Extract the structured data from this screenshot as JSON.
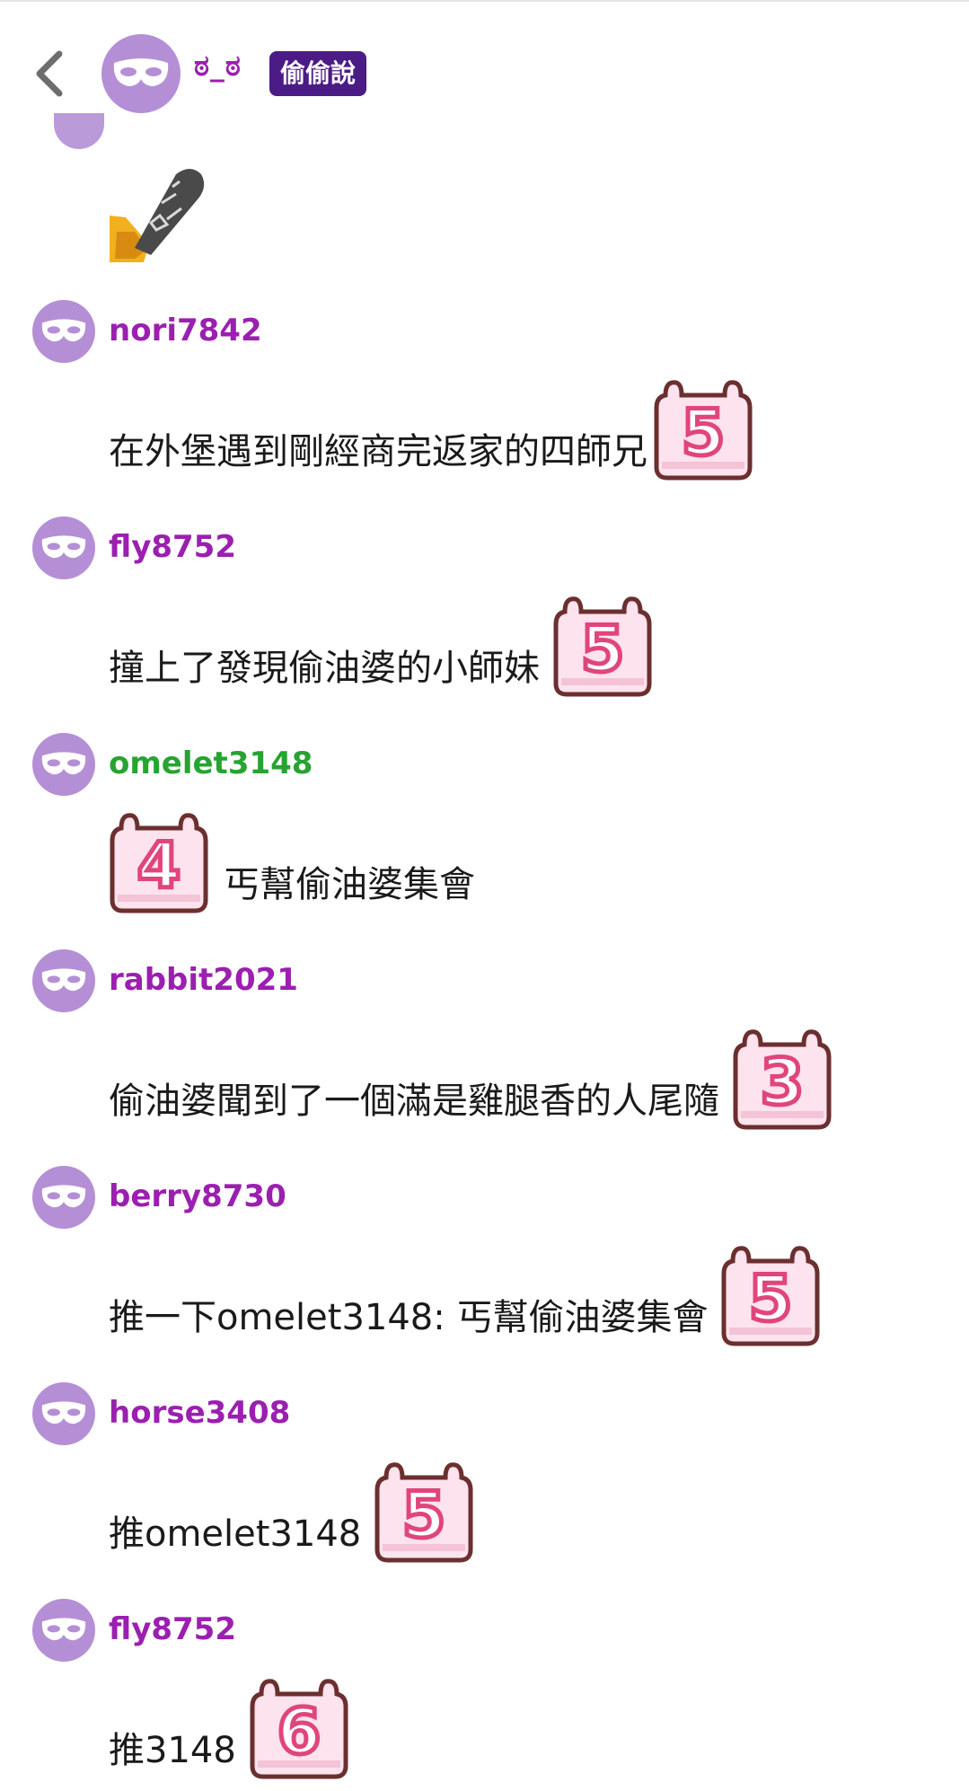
{
  "header": {
    "back_icon": "chevron-left-icon",
    "avatar_icon": "mask-icon",
    "name": "ಠ_ಠ",
    "badge": "偷偷說"
  },
  "top_sticker": {
    "icon": "sword-sticker-icon"
  },
  "colors": {
    "avatar": "#b48fd6",
    "username": "#9b1fb0",
    "username_highlight": "#27a331",
    "badge_bg": "#4b1b86",
    "emote_bg": "#fde3ee",
    "emote_border": "#6b2f2f",
    "emote_digit": "#e0457b"
  },
  "messages": [
    {
      "user": "nori7842",
      "text": "在外堡遇到剛經商完返家的四師兄",
      "emote": "5",
      "emote_before": false
    },
    {
      "user": "fly8752",
      "text": "撞上了發現偷油婆的小師妹",
      "emote": "5",
      "emote_before": false
    },
    {
      "user": "omelet3148",
      "text": "丐幫偷油婆集會",
      "emote": "4",
      "emote_before": true
    },
    {
      "user": "rabbit2021",
      "text": "偷油婆聞到了一個滿是雞腿香的人尾隨",
      "emote": "3",
      "emote_before": false
    },
    {
      "user": "berry8730",
      "text": "推一下omelet3148: 丐幫偷油婆集會",
      "emote": "5",
      "emote_before": false
    },
    {
      "user": "horse3408",
      "text": "推omelet3148",
      "emote": "5",
      "emote_before": false
    },
    {
      "user": "fly8752",
      "text": "推3148",
      "emote": "6",
      "emote_before": false
    }
  ]
}
